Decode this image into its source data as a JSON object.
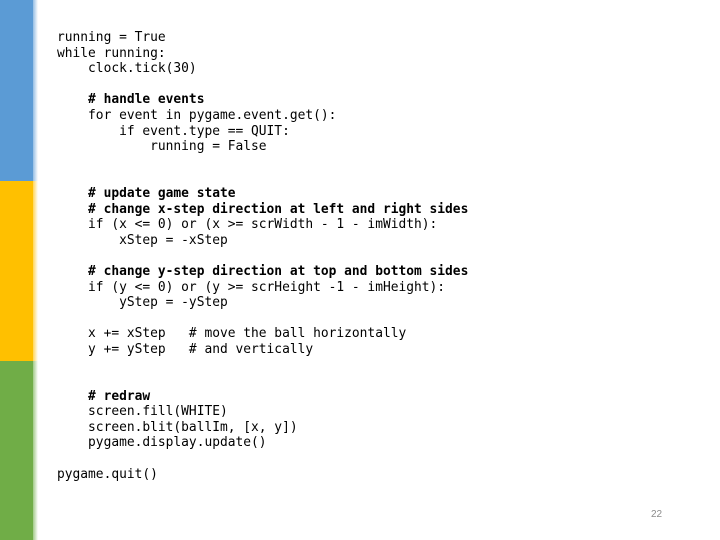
{
  "slide": {
    "page_number": "22",
    "side_bar_colors": {
      "top": "#5b9bd5",
      "middle": "#ffc000",
      "bottom": "#70ad47"
    }
  },
  "code": {
    "lines": [
      {
        "text": "running = True",
        "bold": false
      },
      {
        "text": "while running:",
        "bold": false
      },
      {
        "text": "    clock.tick(30)",
        "bold": false
      },
      {
        "text": "",
        "bold": false
      },
      {
        "text": "    # handle events",
        "bold": true
      },
      {
        "text": "    for event in pygame.event.get():",
        "bold": false
      },
      {
        "text": "        if event.type == QUIT:",
        "bold": false
      },
      {
        "text": "            running = False",
        "bold": false
      },
      {
        "text": "",
        "bold": false
      },
      {
        "text": "",
        "bold": false
      },
      {
        "text": "    # update game state",
        "bold": true
      },
      {
        "text": "    # change x-step direction at left and right sides",
        "bold": true
      },
      {
        "text": "    if (x <= 0) or (x >= scrWidth - 1 - imWidth):",
        "bold": false
      },
      {
        "text": "        xStep = -xStep",
        "bold": false
      },
      {
        "text": "",
        "bold": false
      },
      {
        "text": "    # change y-step direction at top and bottom sides",
        "bold": true
      },
      {
        "text": "    if (y <= 0) or (y >= scrHeight -1 - imHeight):",
        "bold": false
      },
      {
        "text": "        yStep = -yStep",
        "bold": false
      },
      {
        "text": "",
        "bold": false
      },
      {
        "text": "    x += xStep   # move the ball horizontally",
        "bold": false
      },
      {
        "text": "    y += yStep   # and vertically",
        "bold": false
      },
      {
        "text": "",
        "bold": false
      },
      {
        "text": "",
        "bold": false
      },
      {
        "text": "    # redraw",
        "bold": true
      },
      {
        "text": "    screen.fill(WHITE)",
        "bold": false
      },
      {
        "text": "    screen.blit(ballIm, [x, y])",
        "bold": false
      },
      {
        "text": "    pygame.display.update()",
        "bold": false
      },
      {
        "text": "",
        "bold": false
      },
      {
        "text": "pygame.quit()",
        "bold": false
      }
    ]
  }
}
